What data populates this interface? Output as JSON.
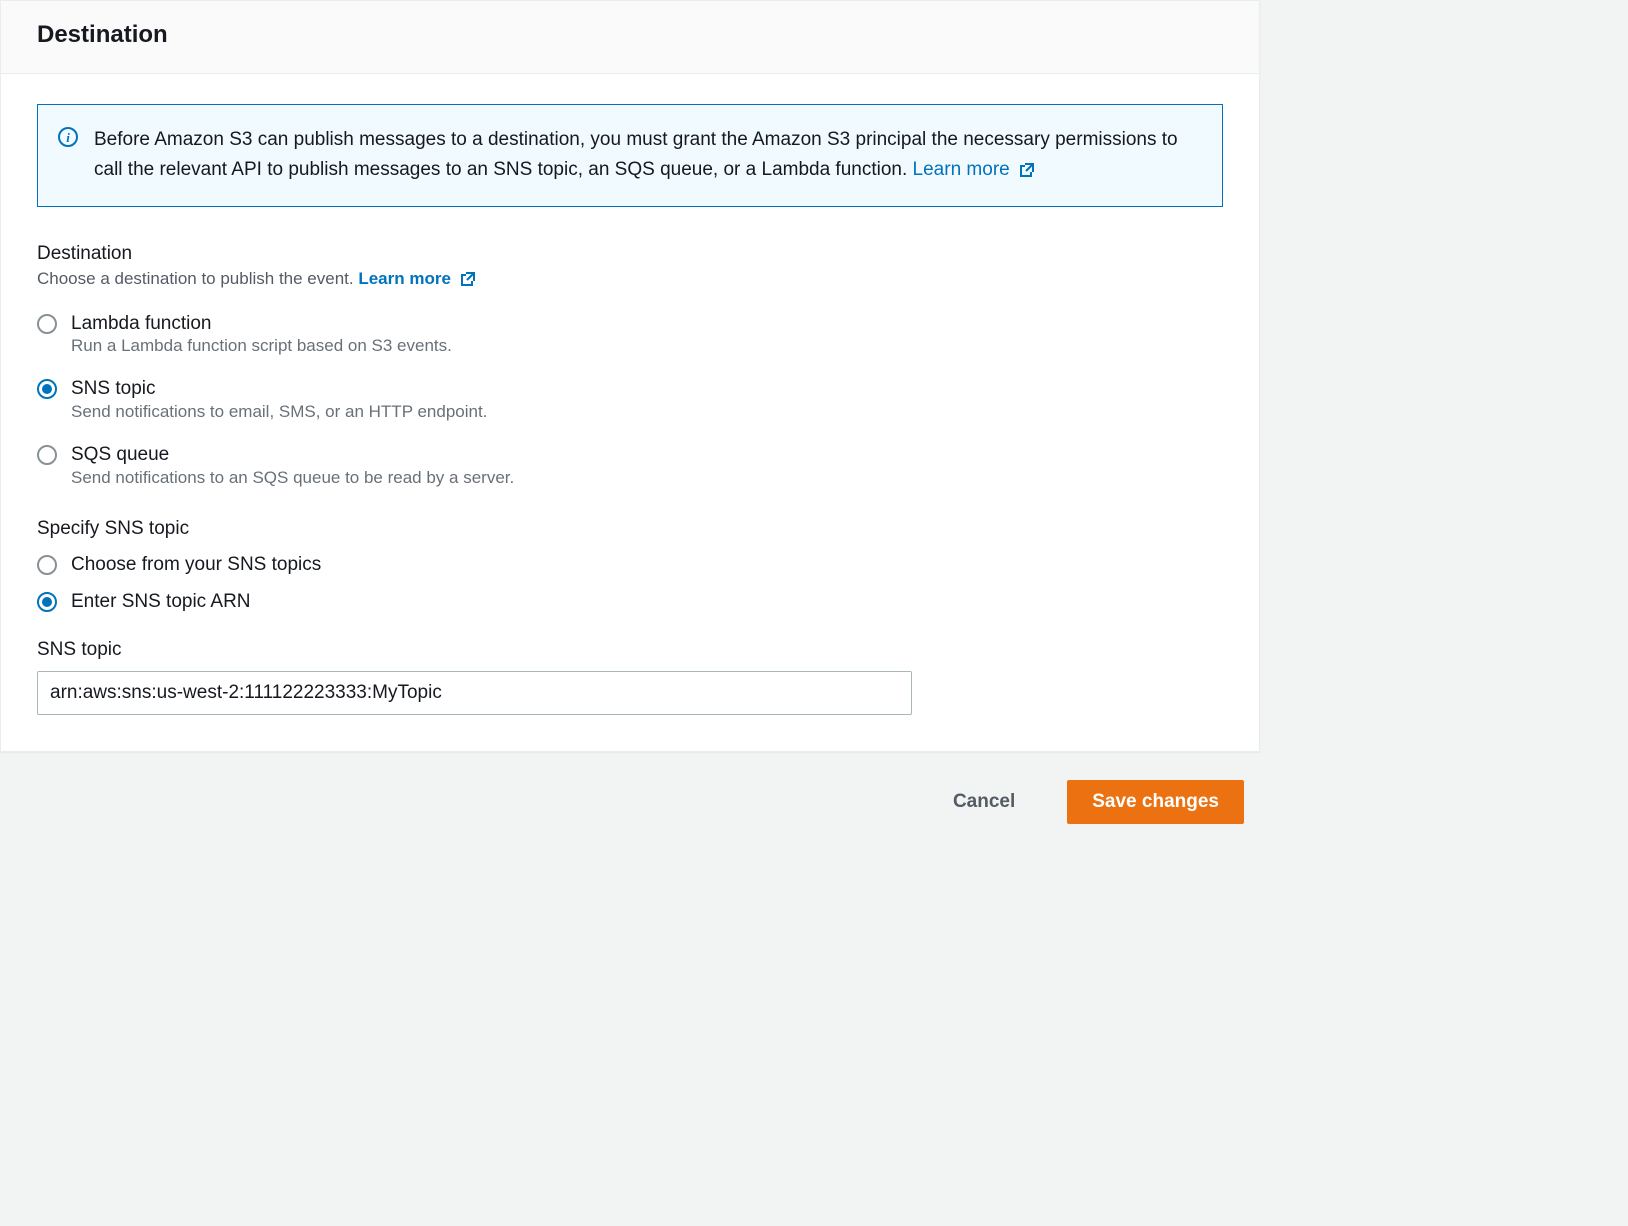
{
  "panel": {
    "title": "Destination"
  },
  "infoBox": {
    "text": "Before Amazon S3 can publish messages to a destination, you must grant the Amazon S3 principal the necessary permissions to call the relevant API to publish messages to an SNS topic, an SQS queue, or a Lambda function. ",
    "learnMoreLabel": "Learn more"
  },
  "destination": {
    "heading": "Destination",
    "hint": "Choose a destination to publish the event. ",
    "learnMoreLabel": "Learn more",
    "selected": "sns",
    "options": [
      {
        "id": "lambda",
        "label": "Lambda function",
        "desc": "Run a Lambda function script based on S3 events."
      },
      {
        "id": "sns",
        "label": "SNS topic",
        "desc": "Send notifications to email, SMS, or an HTTP endpoint."
      },
      {
        "id": "sqs",
        "label": "SQS queue",
        "desc": "Send notifications to an SQS queue to be read by a server."
      }
    ]
  },
  "specifySns": {
    "heading": "Specify SNS topic",
    "selected": "enter-arn",
    "options": [
      {
        "id": "choose",
        "label": "Choose from your SNS topics"
      },
      {
        "id": "enter-arn",
        "label": "Enter SNS topic ARN"
      }
    ]
  },
  "snsTopic": {
    "label": "SNS topic",
    "value": "arn:aws:sns:us-west-2:111122223333:MyTopic"
  },
  "footer": {
    "cancel": "Cancel",
    "save": "Save changes"
  },
  "colors": {
    "link": "#0073bb",
    "primary": "#ec7211",
    "textMuted": "#687078"
  }
}
